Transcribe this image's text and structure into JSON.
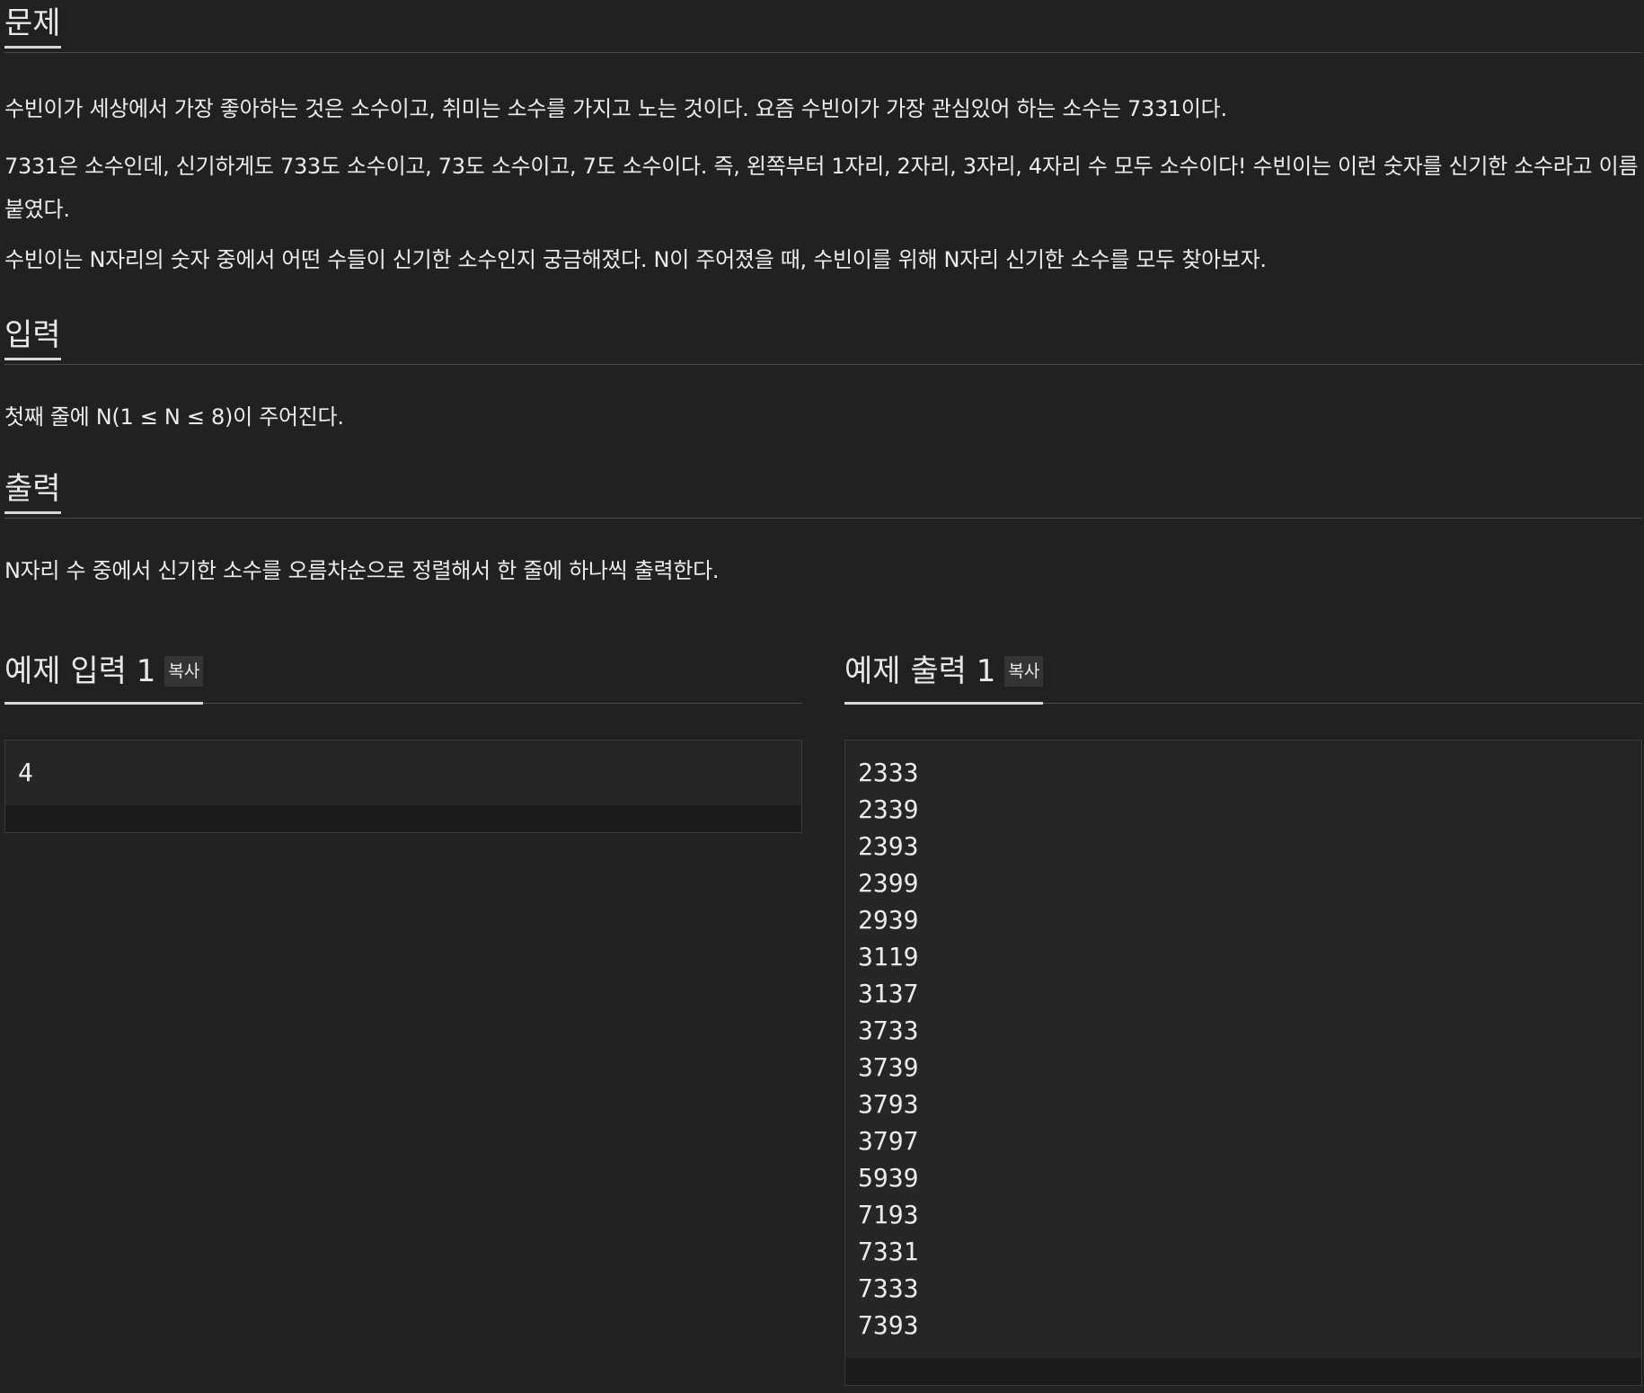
{
  "problem": {
    "heading": "문제",
    "paragraphs": [
      "수빈이가 세상에서 가장 좋아하는 것은 소수이고, 취미는 소수를 가지고 노는 것이다. 요즘 수빈이가 가장 관심있어 하는 소수는 7331이다.",
      "7331은 소수인데, 신기하게도 733도 소수이고, 73도 소수이고, 7도 소수이다. 즉, 왼쪽부터 1자리, 2자리, 3자리, 4자리 수 모두 소수이다! 수빈이는 이런 숫자를 신기한 소수라고 이름 붙였다.",
      "수빈이는 N자리의 숫자 중에서 어떤 수들이 신기한 소수인지 궁금해졌다. N이 주어졌을 때, 수빈이를 위해 N자리 신기한 소수를 모두 찾아보자."
    ]
  },
  "input": {
    "heading": "입력",
    "paragraphs": [
      "첫째 줄에 N(1 ≤ N ≤ 8)이 주어진다."
    ]
  },
  "output": {
    "heading": "출력",
    "paragraphs": [
      "N자리 수 중에서 신기한 소수를 오름차순으로 정렬해서 한 줄에 하나씩 출력한다."
    ]
  },
  "sample_input": {
    "title": "예제 입력 1",
    "copy_label": "복사",
    "lines": [
      "4"
    ]
  },
  "sample_output": {
    "title": "예제 출력 1",
    "copy_label": "복사",
    "lines": [
      "2333",
      "2339",
      "2393",
      "2399",
      "2939",
      "3119",
      "3137",
      "3733",
      "3739",
      "3793",
      "3797",
      "5939",
      "7193",
      "7331",
      "7333",
      "7393"
    ]
  }
}
